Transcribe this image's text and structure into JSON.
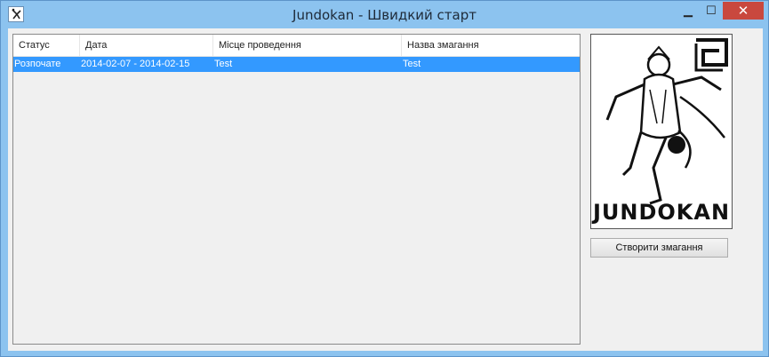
{
  "window": {
    "title": "Jundokan - Швидкий старт"
  },
  "table": {
    "columns": [
      "Статус",
      "Дата",
      "Місце проведення",
      "Назва змагання"
    ],
    "rows": [
      {
        "status": "Розпочате",
        "date": "2014-02-07 - 2014-02-15",
        "venue": "Test",
        "name": "Test"
      }
    ]
  },
  "logo": {
    "text": "JUNDOKAN"
  },
  "actions": {
    "create_button": "Створити змагання"
  },
  "colors": {
    "titlebar": "#8cc3ef",
    "selection": "#3399ff",
    "close": "#c9483e"
  }
}
